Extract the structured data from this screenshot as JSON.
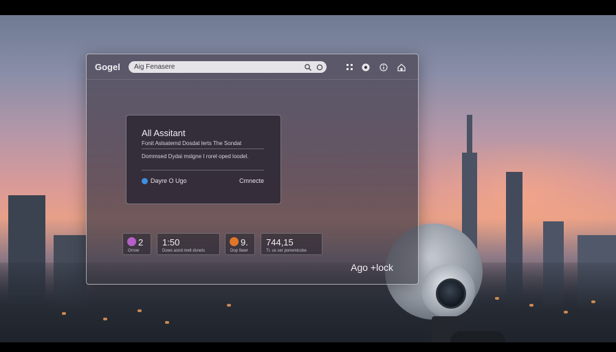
{
  "app": {
    "logo": "Gogel"
  },
  "search": {
    "value": "Aig Fenasere"
  },
  "toolbar_icons": [
    "grid-icon",
    "record-icon",
    "info-icon",
    "home-icon"
  ],
  "assistant_card": {
    "title": "All Assitant",
    "subtitle": "Fonit Aslsatemd Dosdat lerts The Sondat",
    "body": "Dommsed Dydai mslgne I rorel oped loodel.",
    "status": "Dayre O Ugo",
    "connect_label": "Cmnecte"
  },
  "stats": [
    {
      "value": "2",
      "label": "Orrow",
      "badge_color": "#b35fc7"
    },
    {
      "value": "1:50",
      "label": "Dows asnd melt dsnets"
    },
    {
      "value": "9.",
      "label": "Dop 9awr",
      "badge_color": "#e0762a"
    },
    {
      "value": "744,15",
      "label": "Tr. us ser ponemlcsbe"
    }
  ],
  "footer": {
    "label": "Ago +lock"
  },
  "colors": {
    "accent_blue": "#3c8fe0",
    "accent_purple": "#b35fc7",
    "accent_orange": "#e0762a"
  }
}
